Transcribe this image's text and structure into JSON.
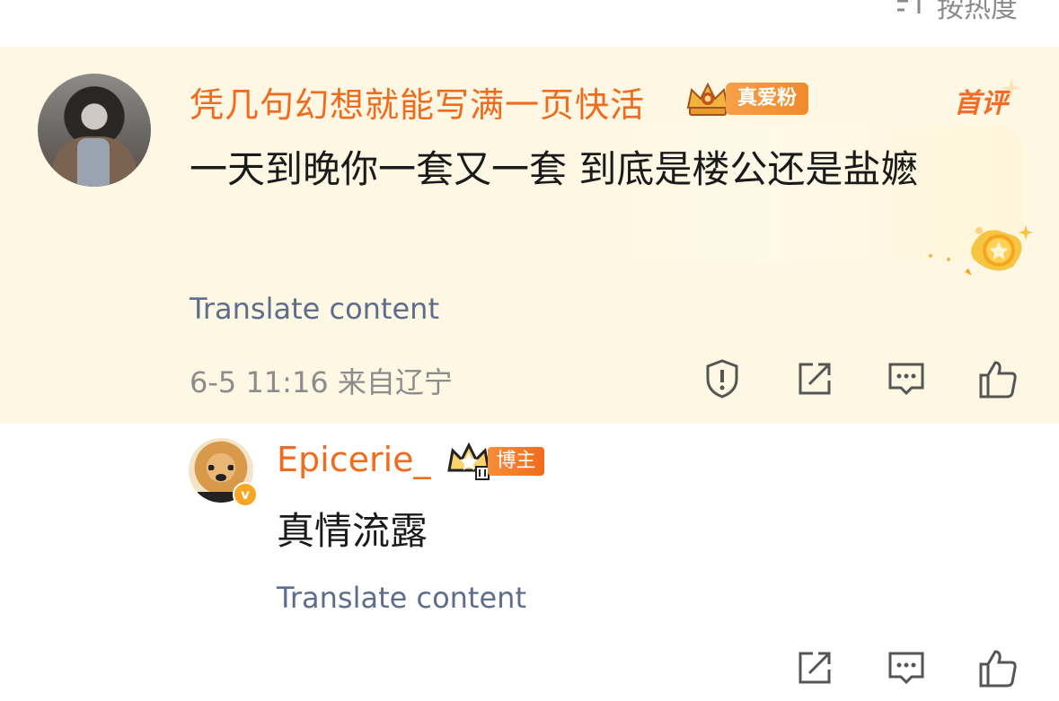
{
  "header": {
    "sort_label": "按热度",
    "sort_icon": "sort-icon"
  },
  "comment": {
    "username": "凭几句幻想就能写满一页快活",
    "fan_badge": "真爱粉",
    "first_tag": "首评",
    "text": "一天到晚你一套又一套 到底是楼公还是盐嬷",
    "translate": "Translate content",
    "meta": "6-5 11:16 来自辽宁",
    "actions": [
      "report-icon",
      "share-icon",
      "comment-icon",
      "like-icon"
    ]
  },
  "reply": {
    "username": "Epicerie_",
    "blogger_badge": "博主",
    "text": "真情流露",
    "translate": "Translate content",
    "actions": [
      "share-icon",
      "comment-icon",
      "like-icon"
    ]
  },
  "colors": {
    "username": "#f06b1d",
    "highlight_bg": "#fdf7e3",
    "translate": "#5d6e8c",
    "meta": "#8c8c8c"
  }
}
